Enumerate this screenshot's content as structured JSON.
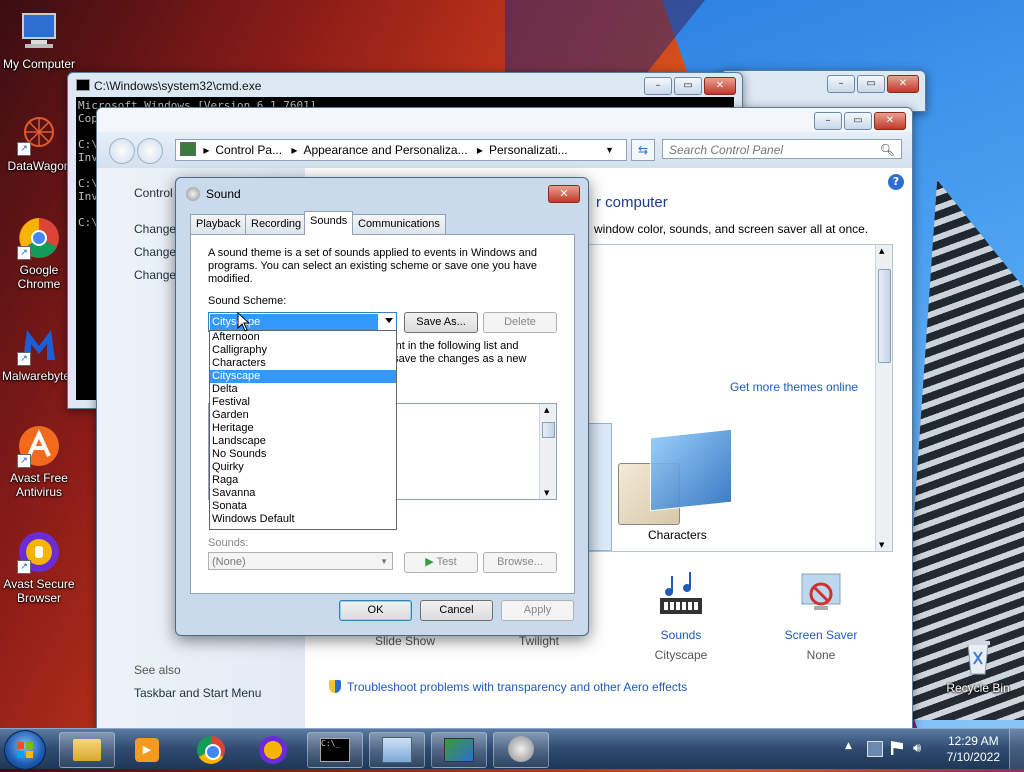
{
  "desktop": {
    "icons": [
      {
        "label": "My Computer"
      },
      {
        "label": "DataWagon"
      },
      {
        "label": "Google Chrome"
      },
      {
        "label": "Malwarebytes"
      },
      {
        "label": "Avast Free Antivirus"
      },
      {
        "label": "Avast Secure Browser"
      },
      {
        "label": "Recycle Bin"
      }
    ]
  },
  "cmd": {
    "title": "C:\\Windows\\system32\\cmd.exe",
    "lines": [
      "Microsoft Windows [Version 6.1.7601]",
      "Cop",
      "",
      "C:\\",
      "Inv",
      "",
      "C:\\",
      "Inv",
      "",
      "C:\\"
    ]
  },
  "control_panel": {
    "breadcrumb": [
      "Control Pa...",
      "Appearance and Personaliza...",
      "Personalizati..."
    ],
    "search_placeholder": "Search Control Panel",
    "left_links": [
      "Control",
      "Change",
      "Change",
      "Change"
    ],
    "heading": "r computer",
    "subheading": "window color, sounds, and screen saver all at once.",
    "more_themes": "Get more themes online",
    "theme_label": "Characters",
    "see_also": "See also",
    "see_also_link": "Taskbar and Start Menu",
    "bottom": [
      {
        "top": "",
        "bottom": "Slide Show"
      },
      {
        "top": "",
        "bottom": "Twilight"
      },
      {
        "top": "Sounds",
        "bottom": "Cityscape"
      },
      {
        "top": "Screen Saver",
        "bottom": "None"
      }
    ],
    "troubleshoot": "Troubleshoot problems with transparency and other Aero effects"
  },
  "sound_dialog": {
    "title": "Sound",
    "tabs": [
      "Playback",
      "Recording",
      "Sounds",
      "Communications"
    ],
    "description": "A sound theme is a set of sounds applied to events in Windows and programs.  You can select an existing scheme or save one you have modified.",
    "scheme_label": "Sound Scheme:",
    "scheme_value": "Cityscape",
    "save_as": "Save As...",
    "delete": "Delete",
    "partial_text_1": "vent in the following list and",
    "partial_text_2": "n save the changes as a new",
    "sounds_label": "Sounds:",
    "sounds_value": "(None)",
    "test": "Test",
    "browse": "Browse...",
    "ok": "OK",
    "cancel": "Cancel",
    "apply": "Apply",
    "scheme_options": [
      "Afternoon",
      "Calligraphy",
      "Characters",
      "Cityscape",
      "Delta",
      "Festival",
      "Garden",
      "Heritage",
      "Landscape",
      "No Sounds",
      "Quirky",
      "Raga",
      "Savanna",
      "Sonata",
      "Windows Default"
    ],
    "selected_index": 3
  },
  "taskbar": {
    "time": "12:29 AM",
    "date": "7/10/2022"
  },
  "colors": {
    "accent": "#3399ff",
    "link": "#1e5bbd"
  }
}
